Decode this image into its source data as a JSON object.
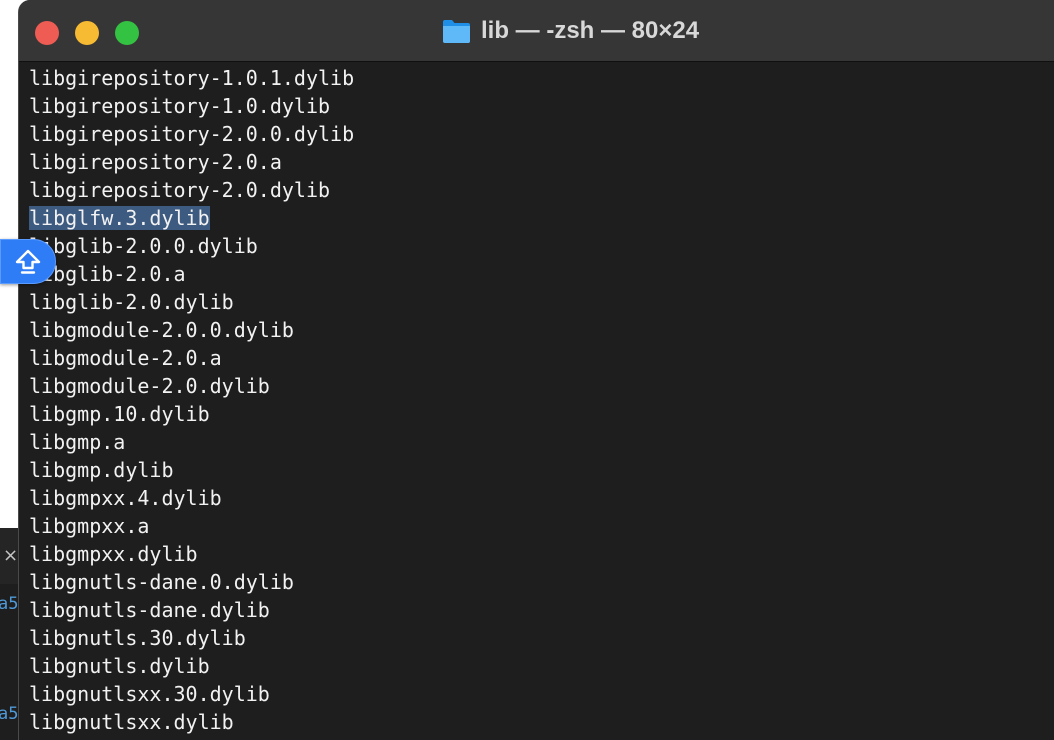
{
  "window": {
    "title": "lib — -zsh — 80×24",
    "folder_icon": "folder-icon",
    "controls": {
      "close": "close-button",
      "minimize": "minimize-button",
      "zoom": "zoom-button"
    }
  },
  "terminal": {
    "selected_index": 5,
    "lines": [
      "libgirepository-1.0.1.dylib",
      "libgirepository-1.0.dylib",
      "libgirepository-2.0.0.dylib",
      "libgirepository-2.0.a",
      "libgirepository-2.0.dylib",
      "libglfw.3.dylib",
      "libglib-2.0.0.dylib",
      "libglib-2.0.a",
      "libglib-2.0.dylib",
      "libgmodule-2.0.0.dylib",
      "libgmodule-2.0.a",
      "libgmodule-2.0.dylib",
      "libgmp.10.dylib",
      "libgmp.a",
      "libgmp.dylib",
      "libgmpxx.4.dylib",
      "libgmpxx.a",
      "libgmpxx.dylib",
      "libgnutls-dane.0.dylib",
      "libgnutls-dane.dylib",
      "libgnutls.30.dylib",
      "libgnutls.dylib",
      "libgnutlsxx.30.dylib",
      "libgnutlsxx.dylib"
    ]
  },
  "floating_button": {
    "icon": "upload-arrow-icon"
  },
  "background_window": {
    "close_glyph": "×",
    "fragment_1": "a5",
    "fragment_2": "a5"
  },
  "colors": {
    "terminal_bg": "#1e1e1e",
    "titlebar_bg": "#363636",
    "text": "#f2f2f2",
    "selection": "#3d5a80",
    "accent_blue": "#2e7cf6",
    "close": "#ee5c54",
    "minimize": "#f6bb32",
    "zoom": "#34c242"
  }
}
